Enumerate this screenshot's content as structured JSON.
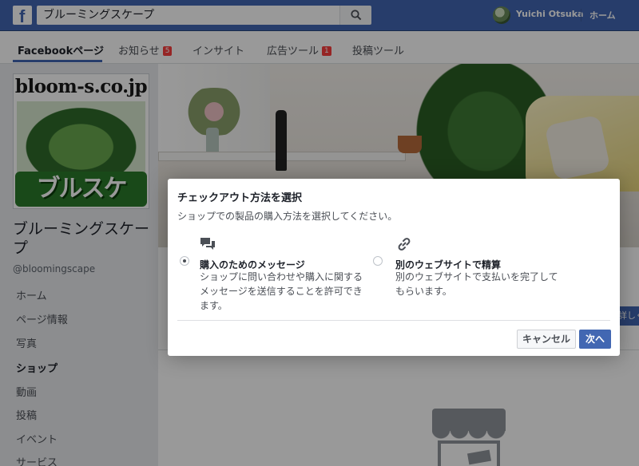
{
  "topbar": {
    "search_value": "ブルーミングスケープ",
    "user_name": "Yuichi Otsuka",
    "home_label": "ホーム",
    "brand_color": "#4267b2"
  },
  "tabs": [
    {
      "label": "Facebookページ",
      "badge": null
    },
    {
      "label": "お知らせ",
      "badge": "5"
    },
    {
      "label": "インサイト",
      "badge": null
    },
    {
      "label": "広告ツール",
      "badge": "1"
    },
    {
      "label": "投稿ツール",
      "badge": null
    }
  ],
  "profile": {
    "pic_url_text": "bloom-s.co.jp",
    "pic_brand_text": "ブルスケ",
    "page_name": "ブルーミングスケープ",
    "handle": "@bloomingscape"
  },
  "sidebar": {
    "items": [
      {
        "label": "ホーム"
      },
      {
        "label": "ページ情報"
      },
      {
        "label": "写真"
      },
      {
        "label": "ショップ",
        "active": true
      },
      {
        "label": "動画"
      },
      {
        "label": "投稿"
      },
      {
        "label": "イベント"
      },
      {
        "label": "サービス"
      }
    ]
  },
  "background": {
    "edge_button_text": "詳しく"
  },
  "dialog": {
    "title": "チェックアウト方法を選択",
    "subtitle": "ショップでの製品の購入方法を選択してください。",
    "options": [
      {
        "icon": "chat-bubbles-icon",
        "title": "購入のためのメッセージ",
        "description": "ショップに問い合わせや購入に関するメッセージを送信することを許可できます。",
        "selected": true
      },
      {
        "icon": "link-icon",
        "title": "別のウェブサイトで精算",
        "description": "別のウェブサイトで支払いを完了してもらいます。",
        "selected": false
      }
    ],
    "cancel_label": "キャンセル",
    "next_label": "次へ"
  }
}
